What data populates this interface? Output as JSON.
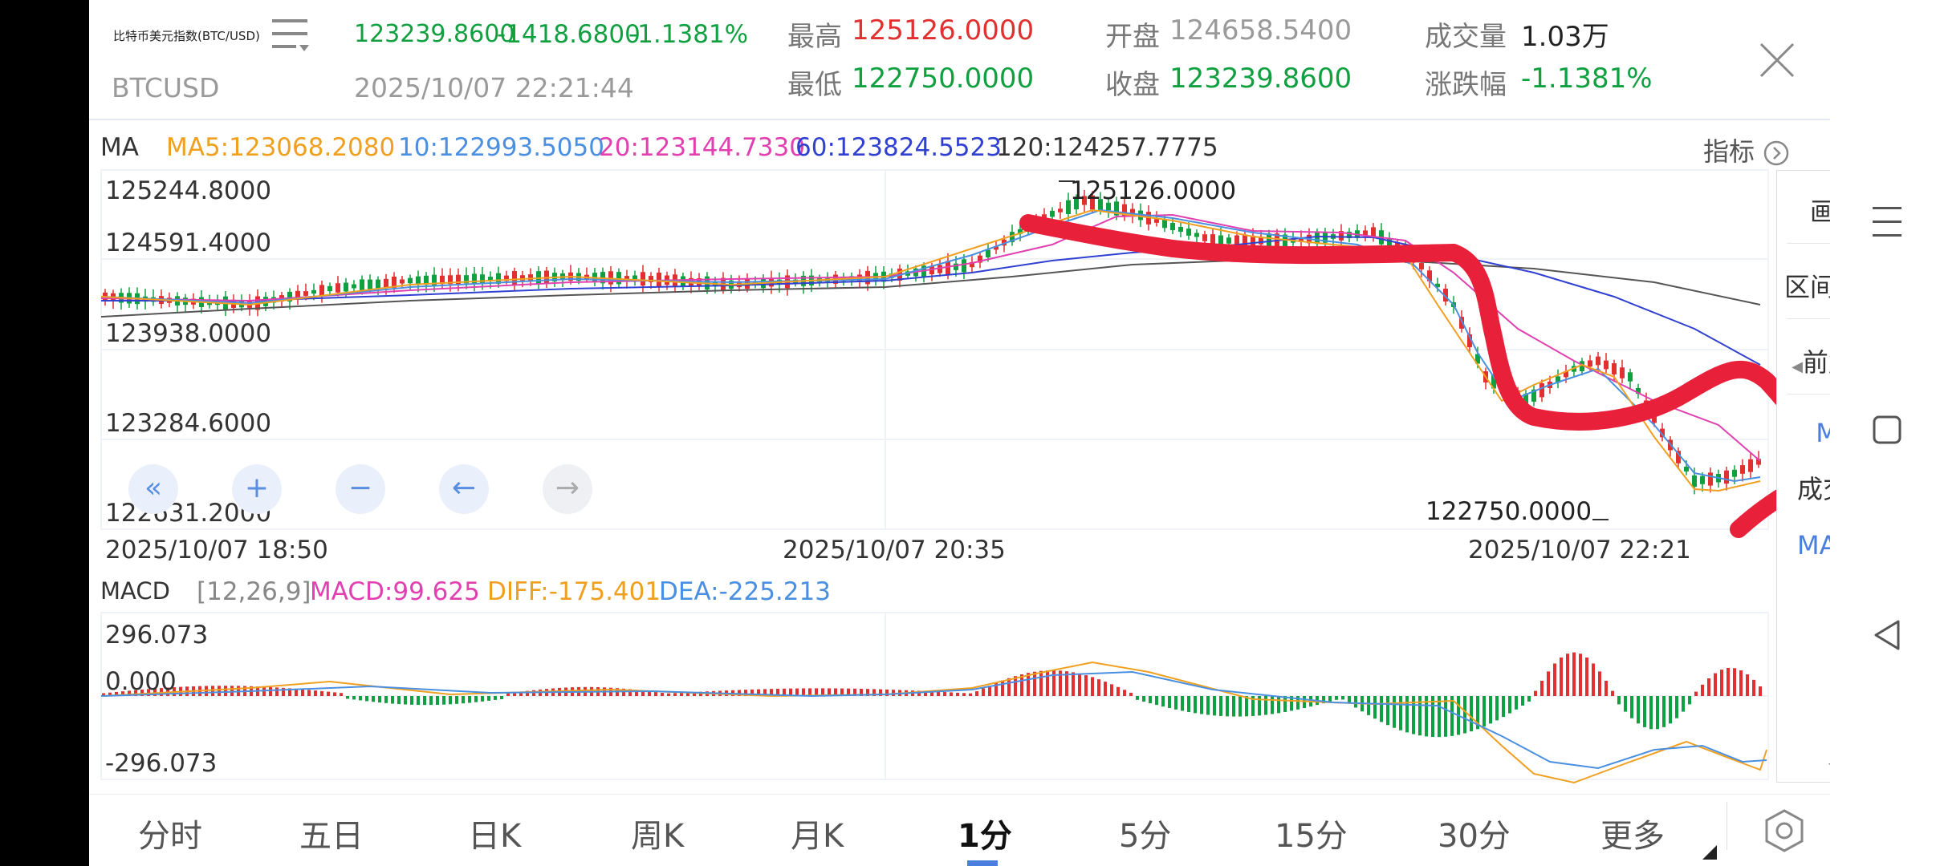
{
  "header": {
    "name": "比特币美元指数(BTC/USD)",
    "symbol": "BTCUSD",
    "price": "123239.8600",
    "change": "-1418.6800",
    "change_pct": "-1.1381%",
    "datetime": "2025/10/07 22:21:44",
    "high_label": "最高",
    "high": "125126.0000",
    "low_label": "最低",
    "low": "122750.0000",
    "open_label": "开盘",
    "open": "124658.5400",
    "close_label": "收盘",
    "close": "123239.8600",
    "volume_label": "成交量",
    "volume": "1.03万",
    "chg_label": "涨跌幅",
    "chg": "-1.1381%"
  },
  "ma": {
    "label": "MA",
    "ma5": "MA5:123068.2080",
    "ma10": "10:122993.5050",
    "ma20": "20:123144.7330",
    "ma60": "60:123824.5523",
    "ma120": "120:124257.7775",
    "indicator_btn": "指标"
  },
  "price_axis": [
    "125244.8000",
    "124591.4000",
    "123938.0000",
    "123284.6000",
    "122631.2000"
  ],
  "annotations": {
    "max": "125126.0000",
    "min": "122750.0000"
  },
  "time_axis": [
    "2025/10/07 18:50",
    "2025/10/07 20:35",
    "2025/10/07 22:21"
  ],
  "macd": {
    "label": "MACD",
    "params": "[12,26,9]",
    "macd": "MACD:99.625",
    "diff": "DIFF:-175.401",
    "dea": "DEA:-225.213",
    "axis": [
      "296.073",
      "0.000",
      "-296.073"
    ]
  },
  "sidebar": [
    "画线",
    "区间统计",
    "前复权",
    "MA",
    "成交量",
    "MACD"
  ],
  "tabs": [
    "分时",
    "五日",
    "日K",
    "周K",
    "月K",
    "1分",
    "5分",
    "15分",
    "30分",
    "更多"
  ],
  "active_tab": "1分",
  "colors": {
    "up": "#e03030",
    "down": "#10a040",
    "ma5": "#f0a020",
    "ma10": "#4a8fe0",
    "ma20": "#e040b0",
    "ma60": "#3040d0",
    "ma120": "#555555",
    "scribble": "#e8203a",
    "accent": "#4a7fe0"
  },
  "icons": [
    "menu-icon",
    "close-icon",
    "chevron-right-icon",
    "double-left-icon",
    "plus-icon",
    "minus-icon",
    "arrow-left-icon",
    "arrow-right-icon",
    "settings-icon",
    "chevron-down-icon",
    "nav-menu-icon",
    "nav-home-icon",
    "nav-back-icon"
  ]
}
